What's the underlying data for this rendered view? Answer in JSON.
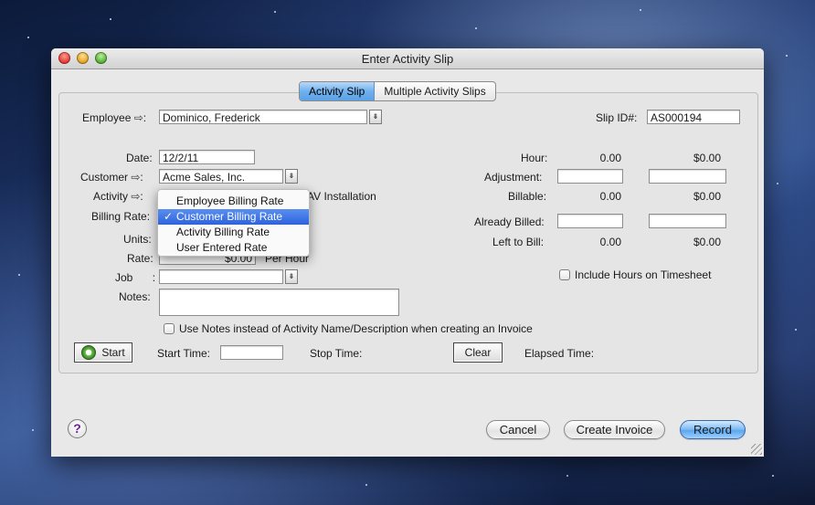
{
  "window": {
    "title": "Enter Activity Slip"
  },
  "tabs": [
    {
      "label": "Activity Slip",
      "active": true
    },
    {
      "label": "Multiple Activity Slips",
      "active": false
    }
  ],
  "form": {
    "employee_label": "Employee",
    "employee_value": "Dominico, Frederick",
    "slip_id_label": "Slip ID#:",
    "slip_id_value": "AS000194",
    "date_label": "Date:",
    "date_value": "12/2/11",
    "customer_label": "Customer",
    "customer_value": "Acme Sales, Inc.",
    "activity_label": "Activity",
    "activity_value_visible": "AV Installation",
    "billing_rate_label": "Billing Rate:",
    "units_label": "Units:",
    "rate_label": "Rate:",
    "rate_value": "$0.00",
    "rate_unit": "Per Hour",
    "job_label": "Job",
    "job_colon": ":",
    "notes_label": "Notes:",
    "use_notes_label": "Use Notes instead of Activity Name/Description when creating an Invoice",
    "colon": ":"
  },
  "summary": {
    "hour_label": "Hour:",
    "hour_value": "0.00",
    "hour_amount": "$0.00",
    "adjustment_label": "Adjustment:",
    "billable_label": "Billable:",
    "billable_value": "0.00",
    "billable_amount": "$0.00",
    "already_billed_label": "Already Billed:",
    "left_to_bill_label": "Left to Bill:",
    "left_value": "0.00",
    "left_amount": "$0.00",
    "include_hours_label": "Include Hours on Timesheet"
  },
  "timer": {
    "start_label": "Start",
    "start_time_label": "Start Time:",
    "stop_time_label": "Stop Time:",
    "clear_label": "Clear",
    "elapsed_label": "Elapsed Time:"
  },
  "billing_rate_menu": {
    "items": [
      {
        "label": "Employee Billing Rate",
        "selected": false
      },
      {
        "label": "Customer Billing Rate",
        "selected": true
      },
      {
        "label": "Activity Billing Rate",
        "selected": false
      },
      {
        "label": "User Entered Rate",
        "selected": false
      }
    ],
    "check_mark": "✓"
  },
  "footer": {
    "help_label": "?",
    "cancel_label": "Cancel",
    "create_invoice_label": "Create Invoice",
    "record_label": "Record"
  },
  "icons": {
    "arrow": "⇨",
    "dropdown": "⇟"
  }
}
